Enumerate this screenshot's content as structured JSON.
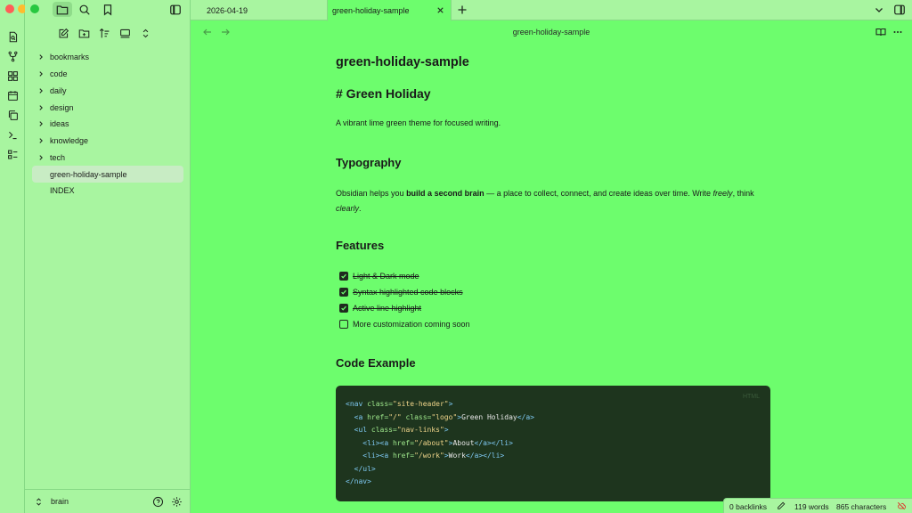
{
  "colors": {
    "editor_bg": "#6dfd6d",
    "sidebar_bg": "#a8f5a0",
    "code_bg": "#1e351e",
    "traffic_red": "#fe5f57",
    "traffic_yellow": "#febc2e",
    "traffic_green": "#28c840"
  },
  "sidebar": {
    "tree": [
      {
        "label": "bookmarks",
        "type": "folder"
      },
      {
        "label": "code",
        "type": "folder"
      },
      {
        "label": "daily",
        "type": "folder"
      },
      {
        "label": "design",
        "type": "folder"
      },
      {
        "label": "ideas",
        "type": "folder"
      },
      {
        "label": "knowledge",
        "type": "folder"
      },
      {
        "label": "tech",
        "type": "folder"
      },
      {
        "label": "green-holiday-sample",
        "type": "file",
        "active": true
      },
      {
        "label": "INDEX",
        "type": "file"
      }
    ],
    "vault_name": "brain"
  },
  "tabs": [
    {
      "label": "2026-04-19"
    },
    {
      "label": "green-holiday-sample",
      "active": true
    }
  ],
  "view_header": {
    "title": "green-holiday-sample"
  },
  "note": {
    "title": "green-holiday-sample",
    "h1": "# Green Holiday",
    "intro": "A vibrant lime green theme for focused writing.",
    "typography_heading": "Typography",
    "para_prefix": "Obsidian helps you ",
    "para_bold": "build a second brain",
    "para_mid": " — a place to collect, connect, and create ideas over time. Write ",
    "para_italic1": "freely",
    "para_mid2": ", think ",
    "para_italic2": "clearly",
    "para_end": ".",
    "features_heading": "Features",
    "tasks": [
      {
        "label": "Light & Dark mode",
        "done": true
      },
      {
        "label": "Syntax highlighted code blocks",
        "done": true
      },
      {
        "label": "Active line highlight",
        "done": true
      },
      {
        "label": "More customization coming soon",
        "done": false
      }
    ],
    "code_heading": "Code Example",
    "code_lang": "HTML",
    "code": {
      "l1_open": "<nav ",
      "l1_attr": "class=",
      "l1_val": "\"site-header\"",
      "l1_close": ">",
      "l2_open": "  <a ",
      "l2_attr1": "href=",
      "l2_val1": "\"/\"",
      "l2_attr2": " class=",
      "l2_val2": "\"logo\"",
      "l2_gt": ">",
      "l2_text": "Green Holiday",
      "l2_end": "</a>",
      "l3_open": "  <ul ",
      "l3_attr": "class=",
      "l3_val": "\"nav-links\"",
      "l3_close": ">",
      "l4_open": "    <li><a ",
      "l4_attr": "href=",
      "l4_val": "\"/about\"",
      "l4_gt": ">",
      "l4_text": "About",
      "l4_end": "</a></li>",
      "l5_open": "    <li><a ",
      "l5_attr": "href=",
      "l5_val": "\"/work\"",
      "l5_gt": ">",
      "l5_text": "Work",
      "l5_end": "</a></li>",
      "l6": "  </ul>",
      "l7": "</nav>"
    }
  },
  "status": {
    "backlinks": "0 backlinks",
    "words": "119 words",
    "characters": "865 characters"
  }
}
